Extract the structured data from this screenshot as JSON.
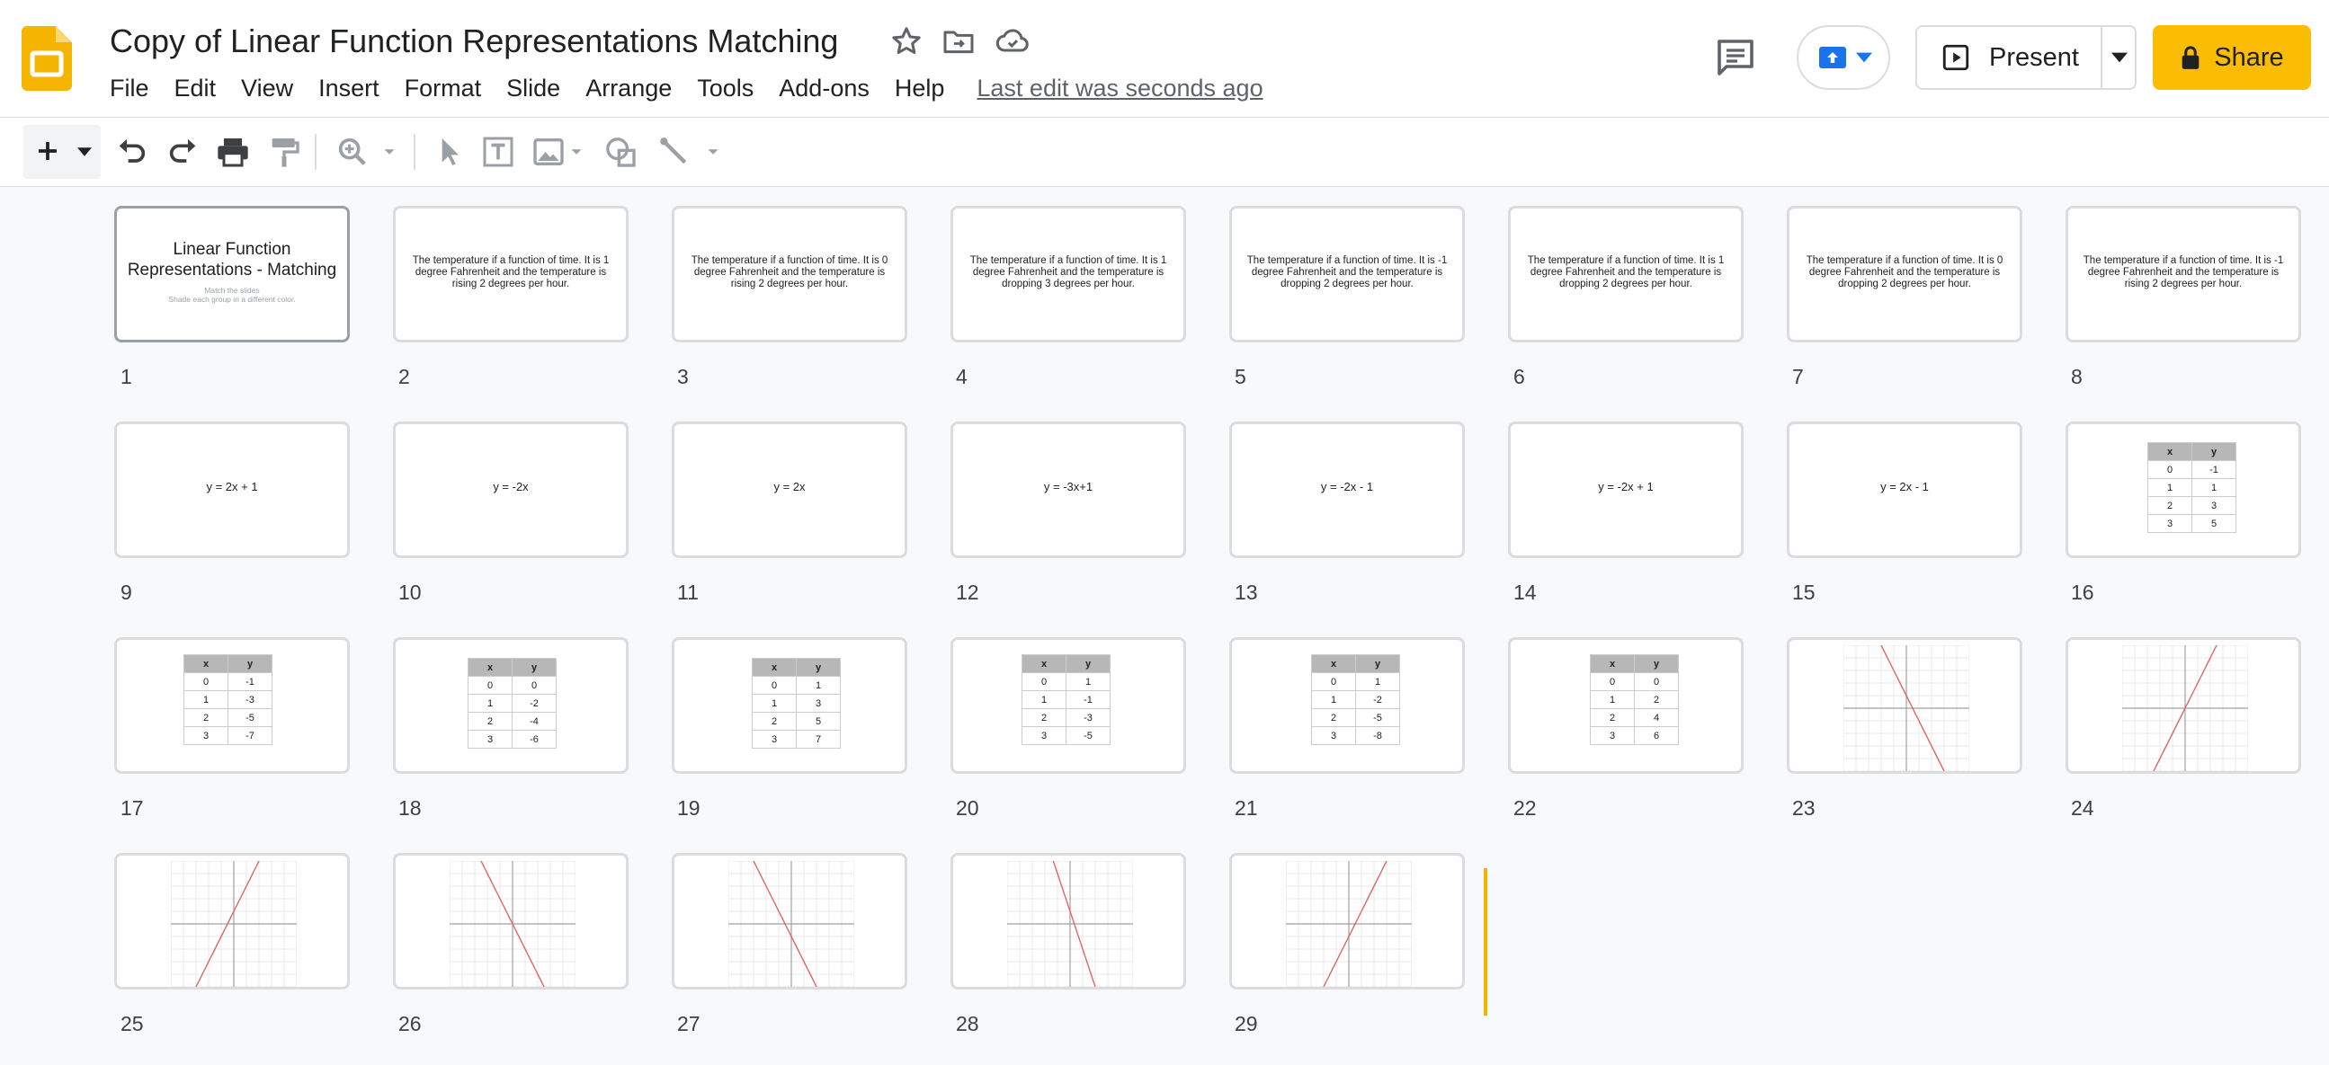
{
  "app": {
    "title": "Copy of Linear Function Representations Matching",
    "menus": [
      "File",
      "Edit",
      "View",
      "Insert",
      "Format",
      "Slide",
      "Arrange",
      "Tools",
      "Add-ons",
      "Help"
    ],
    "last_edit": "Last edit was seconds ago",
    "present_label": "Present",
    "share_label": "Share",
    "colors": {
      "share": "#fbbc04",
      "accent": "#1a73e8",
      "logo": "#f4b400"
    }
  },
  "icons": {
    "logo": "slides-logo-icon",
    "star": "star-icon",
    "move": "move-to-folder-icon",
    "cloud": "cloud-saved-icon",
    "comment": "comment-icon",
    "toolbar": [
      "add-icon",
      "undo-icon",
      "redo-icon",
      "print-icon",
      "paint-format-icon",
      "zoom-icon",
      "select-icon",
      "textbox-icon",
      "image-icon",
      "shape-icon",
      "line-icon"
    ]
  },
  "slide1": {
    "title": "Linear Function Representations - Matching",
    "sub1": "Match the slides",
    "sub2": "Shade each group in a different color."
  },
  "slides": [
    {
      "num": "1"
    },
    {
      "num": "2",
      "text": "The temperature if a function of time. It is 1 degree Fahrenheit and the temperature is rising 2 degrees per hour."
    },
    {
      "num": "3",
      "text": "The temperature if a function of time. It is 0 degree Fahrenheit and the temperature is rising 2 degrees per hour."
    },
    {
      "num": "4",
      "text": "The temperature if a function of time. It is 1 degree Fahrenheit and the temperature is dropping 3 degrees per hour."
    },
    {
      "num": "5",
      "text": "The temperature if a function of time. It is -1 degree Fahrenheit and the temperature is dropping 2 degrees per hour."
    },
    {
      "num": "6",
      "text": "The temperature if a function of time. It is 1 degree Fahrenheit and the temperature is dropping 2 degrees per hour."
    },
    {
      "num": "7",
      "text": "The temperature if a function of time. It is 0 degree Fahrenheit and the temperature is dropping 2 degrees per hour."
    },
    {
      "num": "8",
      "text": "The temperature if a function of time. It is -1 degree Fahrenheit and the temperature is rising 2 degrees per hour."
    },
    {
      "num": "9",
      "eq": "y = 2x + 1"
    },
    {
      "num": "10",
      "eq": "y = -2x"
    },
    {
      "num": "11",
      "eq": "y = 2x"
    },
    {
      "num": "12",
      "eq": "y = -3x+1"
    },
    {
      "num": "13",
      "eq": "y = -2x - 1"
    },
    {
      "num": "14",
      "eq": "y = -2x + 1"
    },
    {
      "num": "15",
      "eq": "y = 2x - 1"
    },
    {
      "num": "16",
      "table": {
        "x": [
          "0",
          "1",
          "2",
          "3"
        ],
        "y": [
          "-1",
          "1",
          "3",
          "5"
        ]
      }
    },
    {
      "num": "17",
      "table": {
        "x": [
          "0",
          "1",
          "2",
          "3"
        ],
        "y": [
          "-1",
          "-3",
          "-5",
          "-7"
        ]
      }
    },
    {
      "num": "18",
      "table": {
        "x": [
          "0",
          "1",
          "2",
          "3"
        ],
        "y": [
          "0",
          "-2",
          "-4",
          "-6"
        ]
      }
    },
    {
      "num": "19",
      "table": {
        "x": [
          "0",
          "1",
          "2",
          "3"
        ],
        "y": [
          "1",
          "3",
          "5",
          "7"
        ]
      }
    },
    {
      "num": "20",
      "table": {
        "x": [
          "0",
          "1",
          "2",
          "3"
        ],
        "y": [
          "1",
          "-1",
          "-3",
          "-5"
        ]
      }
    },
    {
      "num": "21",
      "table": {
        "x": [
          "0",
          "1",
          "2",
          "3"
        ],
        "y": [
          "1",
          "-2",
          "-5",
          "-8"
        ]
      }
    },
    {
      "num": "22",
      "table": {
        "x": [
          "0",
          "1",
          "2",
          "3"
        ],
        "y": [
          "0",
          "2",
          "4",
          "6"
        ]
      }
    },
    {
      "num": "23",
      "graph": {
        "slope": -2,
        "intercept": 1
      }
    },
    {
      "num": "24",
      "graph": {
        "slope": 2,
        "intercept": 0
      }
    },
    {
      "num": "25",
      "graph": {
        "slope": 2,
        "intercept": 1
      }
    },
    {
      "num": "26",
      "graph": {
        "slope": -2,
        "intercept": 0
      }
    },
    {
      "num": "27",
      "graph": {
        "slope": -2,
        "intercept": -1
      }
    },
    {
      "num": "28",
      "graph": {
        "slope": -3,
        "intercept": 1
      }
    },
    {
      "num": "29",
      "graph": {
        "slope": 2,
        "intercept": -1
      }
    }
  ],
  "table_headers": {
    "x": "x",
    "y": "y"
  }
}
